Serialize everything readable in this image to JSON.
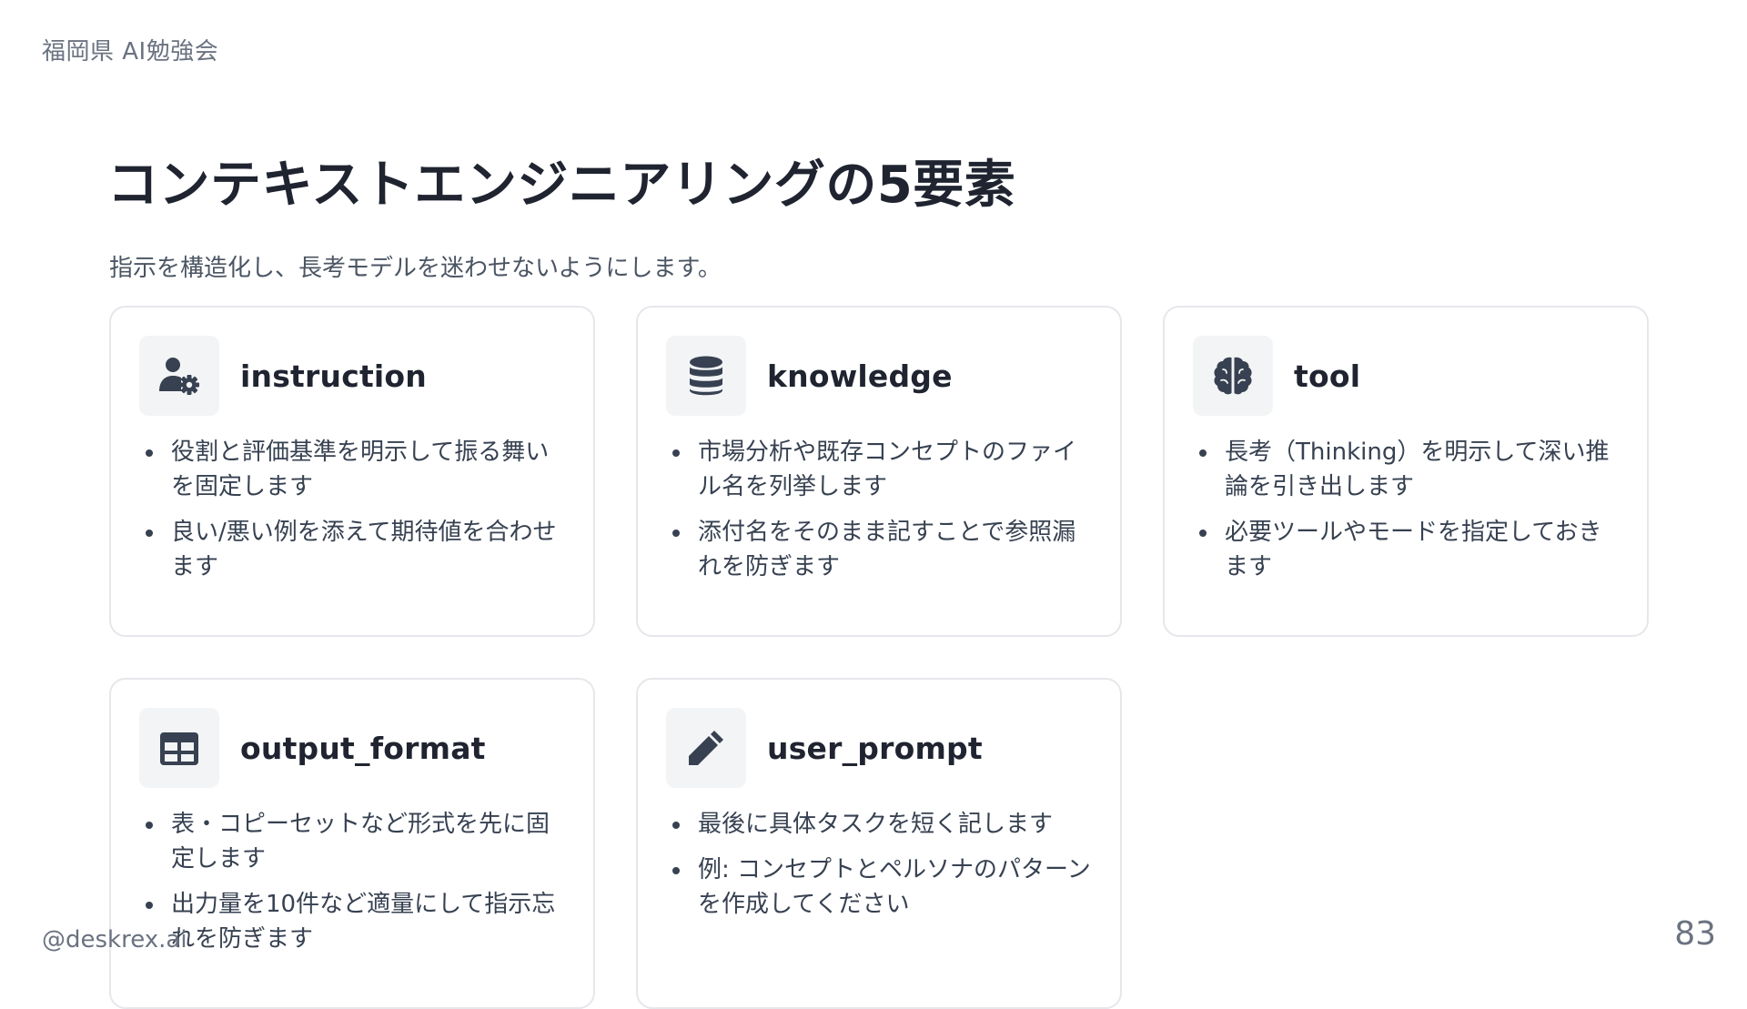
{
  "header": {
    "org": "福岡県 AI勉強会"
  },
  "slide": {
    "title": "コンテキストエンジニアリングの5要素",
    "subtitle": "指示を構造化し、長考モデルを迷わせないようにします。",
    "cards": [
      {
        "title": "instruction",
        "icon": "user-gear-icon",
        "bullets": [
          "役割と評価基準を明示して振る舞いを固定します",
          "良い/悪い例を添えて期待値を合わせます"
        ]
      },
      {
        "title": "knowledge",
        "icon": "database-icon",
        "bullets": [
          "市場分析や既存コンセプトのファイル名を列挙します",
          "添付名をそのまま記すことで参照漏れを防ぎます"
        ]
      },
      {
        "title": "tool",
        "icon": "brain-icon",
        "bullets": [
          "長考（Thinking）を明示して深い推論を引き出します",
          "必要ツールやモードを指定しておきます"
        ]
      },
      {
        "title": "output_format",
        "icon": "table-icon",
        "bullets": [
          "表・コピーセットなど形式を先に固定します",
          "出力量を10件など適量にして指示忘れを防ぎます"
        ]
      },
      {
        "title": "user_prompt",
        "icon": "pencil-icon",
        "bullets": [
          "最後に具体タスクを短く記します",
          "例: コンセプトとペルソナのパターンを作成してください"
        ]
      }
    ]
  },
  "footer": {
    "handle": "@deskrex.ai",
    "page_number": "83"
  },
  "colors": {
    "title": "#1f2430",
    "text": "#374151",
    "muted": "#6b7280",
    "card_border": "#e5e7eb",
    "icon_bg": "#f3f4f6",
    "icon_fg": "#374151"
  }
}
